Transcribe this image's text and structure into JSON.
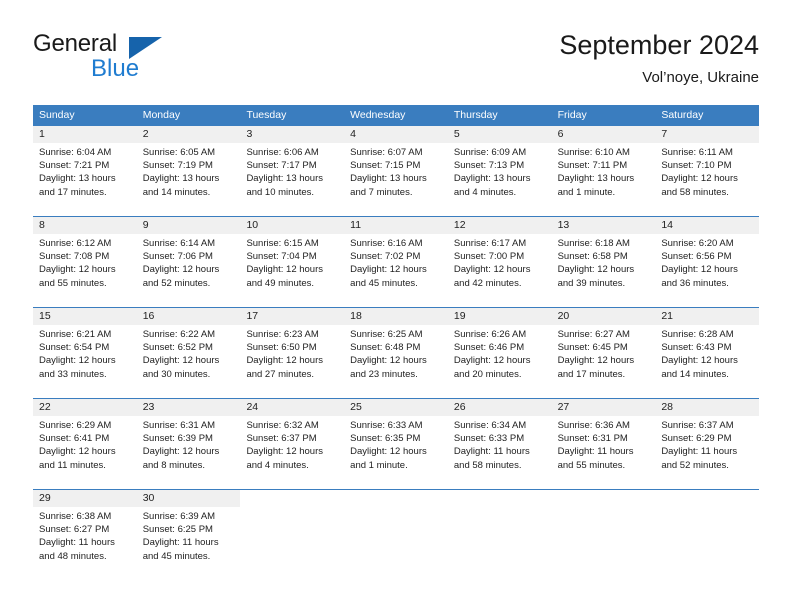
{
  "brand": {
    "word_general": "General",
    "word_blue": "Blue",
    "triangle_color": "#1663ab",
    "blue_color": "#1f7cd0"
  },
  "header": {
    "title": "September 2024",
    "location": "Vol’noye, Ukraine"
  },
  "theme": {
    "header_bg": "#3a7dbf",
    "header_text": "#ffffff",
    "daynum_band_bg": "#f0f0f0",
    "row_divider": "#3a7dbf",
    "body_text": "#222222"
  },
  "weekdays": [
    "Sunday",
    "Monday",
    "Tuesday",
    "Wednesday",
    "Thursday",
    "Friday",
    "Saturday"
  ],
  "weeks": [
    [
      {
        "day": "1",
        "sunrise": "Sunrise: 6:04 AM",
        "sunset": "Sunset: 7:21 PM",
        "daylight1": "Daylight: 13 hours",
        "daylight2": "and 17 minutes."
      },
      {
        "day": "2",
        "sunrise": "Sunrise: 6:05 AM",
        "sunset": "Sunset: 7:19 PM",
        "daylight1": "Daylight: 13 hours",
        "daylight2": "and 14 minutes."
      },
      {
        "day": "3",
        "sunrise": "Sunrise: 6:06 AM",
        "sunset": "Sunset: 7:17 PM",
        "daylight1": "Daylight: 13 hours",
        "daylight2": "and 10 minutes."
      },
      {
        "day": "4",
        "sunrise": "Sunrise: 6:07 AM",
        "sunset": "Sunset: 7:15 PM",
        "daylight1": "Daylight: 13 hours",
        "daylight2": "and 7 minutes."
      },
      {
        "day": "5",
        "sunrise": "Sunrise: 6:09 AM",
        "sunset": "Sunset: 7:13 PM",
        "daylight1": "Daylight: 13 hours",
        "daylight2": "and 4 minutes."
      },
      {
        "day": "6",
        "sunrise": "Sunrise: 6:10 AM",
        "sunset": "Sunset: 7:11 PM",
        "daylight1": "Daylight: 13 hours",
        "daylight2": "and 1 minute."
      },
      {
        "day": "7",
        "sunrise": "Sunrise: 6:11 AM",
        "sunset": "Sunset: 7:10 PM",
        "daylight1": "Daylight: 12 hours",
        "daylight2": "and 58 minutes."
      }
    ],
    [
      {
        "day": "8",
        "sunrise": "Sunrise: 6:12 AM",
        "sunset": "Sunset: 7:08 PM",
        "daylight1": "Daylight: 12 hours",
        "daylight2": "and 55 minutes."
      },
      {
        "day": "9",
        "sunrise": "Sunrise: 6:14 AM",
        "sunset": "Sunset: 7:06 PM",
        "daylight1": "Daylight: 12 hours",
        "daylight2": "and 52 minutes."
      },
      {
        "day": "10",
        "sunrise": "Sunrise: 6:15 AM",
        "sunset": "Sunset: 7:04 PM",
        "daylight1": "Daylight: 12 hours",
        "daylight2": "and 49 minutes."
      },
      {
        "day": "11",
        "sunrise": "Sunrise: 6:16 AM",
        "sunset": "Sunset: 7:02 PM",
        "daylight1": "Daylight: 12 hours",
        "daylight2": "and 45 minutes."
      },
      {
        "day": "12",
        "sunrise": "Sunrise: 6:17 AM",
        "sunset": "Sunset: 7:00 PM",
        "daylight1": "Daylight: 12 hours",
        "daylight2": "and 42 minutes."
      },
      {
        "day": "13",
        "sunrise": "Sunrise: 6:18 AM",
        "sunset": "Sunset: 6:58 PM",
        "daylight1": "Daylight: 12 hours",
        "daylight2": "and 39 minutes."
      },
      {
        "day": "14",
        "sunrise": "Sunrise: 6:20 AM",
        "sunset": "Sunset: 6:56 PM",
        "daylight1": "Daylight: 12 hours",
        "daylight2": "and 36 minutes."
      }
    ],
    [
      {
        "day": "15",
        "sunrise": "Sunrise: 6:21 AM",
        "sunset": "Sunset: 6:54 PM",
        "daylight1": "Daylight: 12 hours",
        "daylight2": "and 33 minutes."
      },
      {
        "day": "16",
        "sunrise": "Sunrise: 6:22 AM",
        "sunset": "Sunset: 6:52 PM",
        "daylight1": "Daylight: 12 hours",
        "daylight2": "and 30 minutes."
      },
      {
        "day": "17",
        "sunrise": "Sunrise: 6:23 AM",
        "sunset": "Sunset: 6:50 PM",
        "daylight1": "Daylight: 12 hours",
        "daylight2": "and 27 minutes."
      },
      {
        "day": "18",
        "sunrise": "Sunrise: 6:25 AM",
        "sunset": "Sunset: 6:48 PM",
        "daylight1": "Daylight: 12 hours",
        "daylight2": "and 23 minutes."
      },
      {
        "day": "19",
        "sunrise": "Sunrise: 6:26 AM",
        "sunset": "Sunset: 6:46 PM",
        "daylight1": "Daylight: 12 hours",
        "daylight2": "and 20 minutes."
      },
      {
        "day": "20",
        "sunrise": "Sunrise: 6:27 AM",
        "sunset": "Sunset: 6:45 PM",
        "daylight1": "Daylight: 12 hours",
        "daylight2": "and 17 minutes."
      },
      {
        "day": "21",
        "sunrise": "Sunrise: 6:28 AM",
        "sunset": "Sunset: 6:43 PM",
        "daylight1": "Daylight: 12 hours",
        "daylight2": "and 14 minutes."
      }
    ],
    [
      {
        "day": "22",
        "sunrise": "Sunrise: 6:29 AM",
        "sunset": "Sunset: 6:41 PM",
        "daylight1": "Daylight: 12 hours",
        "daylight2": "and 11 minutes."
      },
      {
        "day": "23",
        "sunrise": "Sunrise: 6:31 AM",
        "sunset": "Sunset: 6:39 PM",
        "daylight1": "Daylight: 12 hours",
        "daylight2": "and 8 minutes."
      },
      {
        "day": "24",
        "sunrise": "Sunrise: 6:32 AM",
        "sunset": "Sunset: 6:37 PM",
        "daylight1": "Daylight: 12 hours",
        "daylight2": "and 4 minutes."
      },
      {
        "day": "25",
        "sunrise": "Sunrise: 6:33 AM",
        "sunset": "Sunset: 6:35 PM",
        "daylight1": "Daylight: 12 hours",
        "daylight2": "and 1 minute."
      },
      {
        "day": "26",
        "sunrise": "Sunrise: 6:34 AM",
        "sunset": "Sunset: 6:33 PM",
        "daylight1": "Daylight: 11 hours",
        "daylight2": "and 58 minutes."
      },
      {
        "day": "27",
        "sunrise": "Sunrise: 6:36 AM",
        "sunset": "Sunset: 6:31 PM",
        "daylight1": "Daylight: 11 hours",
        "daylight2": "and 55 minutes."
      },
      {
        "day": "28",
        "sunrise": "Sunrise: 6:37 AM",
        "sunset": "Sunset: 6:29 PM",
        "daylight1": "Daylight: 11 hours",
        "daylight2": "and 52 minutes."
      }
    ],
    [
      {
        "day": "29",
        "sunrise": "Sunrise: 6:38 AM",
        "sunset": "Sunset: 6:27 PM",
        "daylight1": "Daylight: 11 hours",
        "daylight2": "and 48 minutes."
      },
      {
        "day": "30",
        "sunrise": "Sunrise: 6:39 AM",
        "sunset": "Sunset: 6:25 PM",
        "daylight1": "Daylight: 11 hours",
        "daylight2": "and 45 minutes."
      },
      {
        "day": "",
        "sunrise": "",
        "sunset": "",
        "daylight1": "",
        "daylight2": ""
      },
      {
        "day": "",
        "sunrise": "",
        "sunset": "",
        "daylight1": "",
        "daylight2": ""
      },
      {
        "day": "",
        "sunrise": "",
        "sunset": "",
        "daylight1": "",
        "daylight2": ""
      },
      {
        "day": "",
        "sunrise": "",
        "sunset": "",
        "daylight1": "",
        "daylight2": ""
      },
      {
        "day": "",
        "sunrise": "",
        "sunset": "",
        "daylight1": "",
        "daylight2": ""
      }
    ]
  ]
}
